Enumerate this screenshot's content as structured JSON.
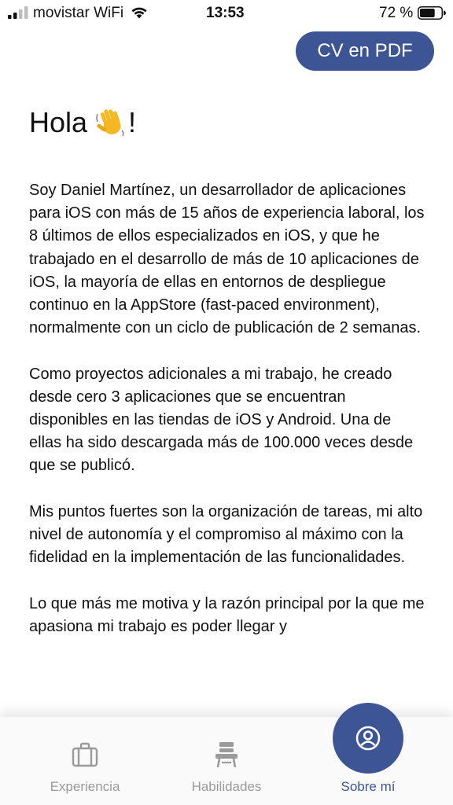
{
  "status_bar": {
    "carrier": "movistar WiFi",
    "time": "13:53",
    "battery_percent": "72 %",
    "battery_level": 0.72
  },
  "header": {
    "cv_button_label": "CV en PDF",
    "greeting": "Hola",
    "greeting_suffix": "!"
  },
  "body": {
    "paragraphs": [
      "Soy Daniel Martínez, un desarrollador de aplicaciones para iOS con más de 15 años de experiencia laboral, los 8 últimos de ellos especializados en iOS, y que he trabajado en el desarrollo de más de 10 aplicaciones de iOS, la mayoría de ellas en entornos de despliegue continuo en la AppStore (fast-paced environment), normalmente con un ciclo de publicación de 2 semanas.",
      "Como proyectos adicionales a mi trabajo, he creado desde cero 3 aplicaciones que se encuentran disponibles en las tiendas de iOS y Android. Una de ellas ha sido descargada más de 100.000 veces desde que se publicó.",
      "Mis puntos fuertes son la organización de tareas, mi alto nivel de autonomía y el compromiso al máximo con la fidelidad en la implementación de las funcionalidades.",
      "Lo que más me motiva y la razón principal por la que me apasiona mi trabajo es poder llegar y"
    ]
  },
  "tabs": [
    {
      "label": "Experiencia",
      "icon": "briefcase-icon",
      "active": false
    },
    {
      "label": "Habilidades",
      "icon": "desk-chair-icon",
      "active": false
    },
    {
      "label": "Sobre mí",
      "icon": "user-circle-icon",
      "active": true
    }
  ],
  "colors": {
    "accent": "#3d5495",
    "inactive_tab": "#9a9a9a"
  }
}
